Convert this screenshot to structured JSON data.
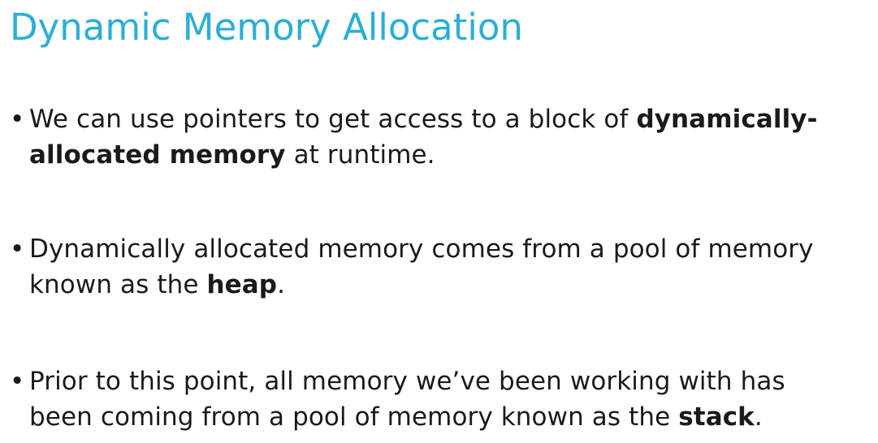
{
  "slide": {
    "title": "Dynamic Memory Allocation",
    "bullet_symbol": "•",
    "bullets": [
      {
        "line1_plain": "We can use pointers to get access to a block of ",
        "line1_bold": "dynamically-",
        "line2_bold": "allocated memory",
        "line2_plain": " at runtime."
      },
      {
        "line1_plain": "Dynamically allocated memory comes from a pool of memory",
        "line2_plain": "known as the ",
        "line2_bold": "heap",
        "line2_end": "."
      },
      {
        "line1_plain": "Prior to this point, all memory we’ve been working with has",
        "line2_plain": "been coming from a pool of memory known as the ",
        "line2_bold": "stack",
        "line2_end": "."
      }
    ]
  }
}
